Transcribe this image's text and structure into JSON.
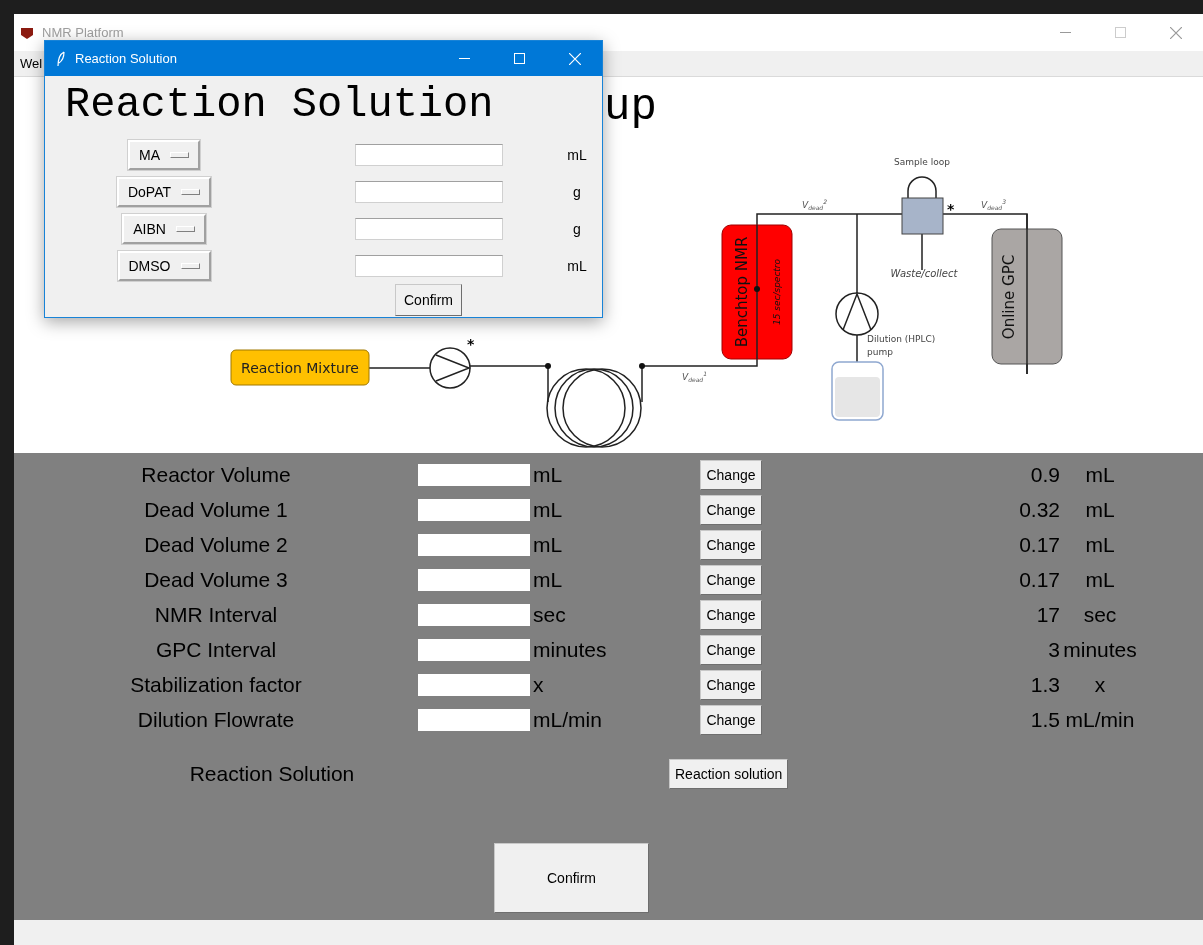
{
  "main_window": {
    "title": "NMR Platform",
    "menu": [
      "Wel"
    ],
    "heading": "up"
  },
  "diagram": {
    "reaction_mixture": "Reaction Mixture",
    "nmr": "Benchtop NMR",
    "nmr_rate": "15 sec/spectro",
    "gpc": "Online GPC",
    "sample_loop": "Sample loop",
    "waste": "Waste/collect",
    "dilution_pump": [
      "Dilution (HPLC)",
      "pump"
    ],
    "dead_volumes": [
      {
        "main": "V",
        "sub": "dead",
        "sup": "1"
      },
      {
        "main": "V",
        "sub": "dead",
        "sup": "2"
      },
      {
        "main": "V",
        "sub": "dead",
        "sup": "3"
      }
    ],
    "asterisks": [
      "*",
      "*"
    ]
  },
  "settings": [
    {
      "label": "Reactor Volume",
      "unit": "mL",
      "button": "Change",
      "value": "0.9",
      "value_unit": "mL"
    },
    {
      "label": "Dead Volume 1",
      "unit": "mL",
      "button": "Change",
      "value": "0.32",
      "value_unit": "mL"
    },
    {
      "label": "Dead Volume 2",
      "unit": "mL",
      "button": "Change",
      "value": "0.17",
      "value_unit": "mL"
    },
    {
      "label": "Dead Volume 3",
      "unit": "mL",
      "button": "Change",
      "value": "0.17",
      "value_unit": "mL"
    },
    {
      "label": "NMR Interval",
      "unit": "sec",
      "button": "Change",
      "value": "17",
      "value_unit": "sec"
    },
    {
      "label": "GPC Interval",
      "unit": "minutes",
      "button": "Change",
      "value": "3",
      "value_unit": "minutes"
    },
    {
      "label": "Stabilization factor",
      "unit": "x",
      "button": "Change",
      "value": "1.3",
      "value_unit": "x"
    },
    {
      "label": "Dilution Flowrate",
      "unit": "mL/min",
      "button": "Change",
      "value": "1.5",
      "value_unit": "mL/min"
    }
  ],
  "reaction_solution": {
    "label": "Reaction Solution",
    "button": "Reaction solution"
  },
  "confirm": "Confirm",
  "dialog": {
    "title": "Reaction Solution",
    "heading": "Reaction Solution",
    "components": [
      {
        "name": "MA",
        "unit": "mL"
      },
      {
        "name": "DoPAT",
        "unit": "g"
      },
      {
        "name": "AIBN",
        "unit": "g"
      },
      {
        "name": "DMSO",
        "unit": "mL"
      }
    ],
    "confirm": "Confirm"
  }
}
